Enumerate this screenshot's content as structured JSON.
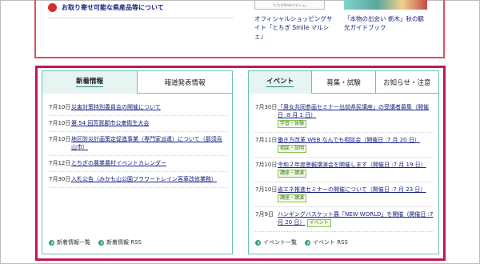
{
  "top": {
    "link_text": "お取り寄せ可能な県産品等について",
    "thumb1_text": "「とちぎSmileマルシェ」",
    "card1_title": "オフィシャルショッピングサイト「とちぎ Smile マルシェ」",
    "card2_title": "「本物の出会い 栃木」秋の観光ガイドブック"
  },
  "left_panel": {
    "tabs": [
      "新着情報",
      "報道発表情報"
    ],
    "items": [
      {
        "date": "7月10日",
        "text": "災害対策特別委員会の開催について"
      },
      {
        "date": "7月10日",
        "text": "第 54 回芳賀郡市公衆衛生大会"
      },
      {
        "date": "7月10日",
        "text": "地区防災計画策定促進事業（専門家派遣）について（那須烏山市）"
      },
      {
        "date": "7月12日",
        "text": "とちぎの農業農村イベントカレンダー"
      },
      {
        "date": "7月30日",
        "text": "入札公告（みかも山公園フラワートレイン客車改修業務）"
      }
    ],
    "footer": [
      "新着情報一覧",
      "新着情報 RSS"
    ]
  },
  "right_panel": {
    "tabs": [
      "イベント",
      "募集・試験",
      "お知らせ・注意"
    ],
    "items": [
      {
        "date": "7月30日",
        "text": "「男女共同参画セミナー出前県民講座」の受講者募集（開催日 :8 月 1 日）",
        "tag": "学習・体験"
      },
      {
        "date": "7月11日",
        "text": "働き方改革 WEB なんでも相談会（開催日 :7 月 20 日）",
        "tag": "相談・説明"
      },
      {
        "date": "7月10日",
        "text": "令和２年度景観講演会を開催します（開催日 :7 月 19 日）",
        "tag": "講座・講演"
      },
      {
        "date": "7月10日",
        "text": "省エネ推進セミナーの開催について（開催日 :7 月 23 日）",
        "tag": "講座・講演"
      },
      {
        "date": "7月9日",
        "text": "ハンギングバスケット展「NEW WORLD」を開催（開催日 :7 月 20 日）",
        "tag": "イベント"
      }
    ],
    "footer": [
      "イベント一覧",
      "イベント RSS"
    ]
  },
  "colors": {
    "teal": "#6cc0b4",
    "highlight": "#c2185b",
    "link": "#1a237e",
    "tag_green": "#8bc34a"
  }
}
